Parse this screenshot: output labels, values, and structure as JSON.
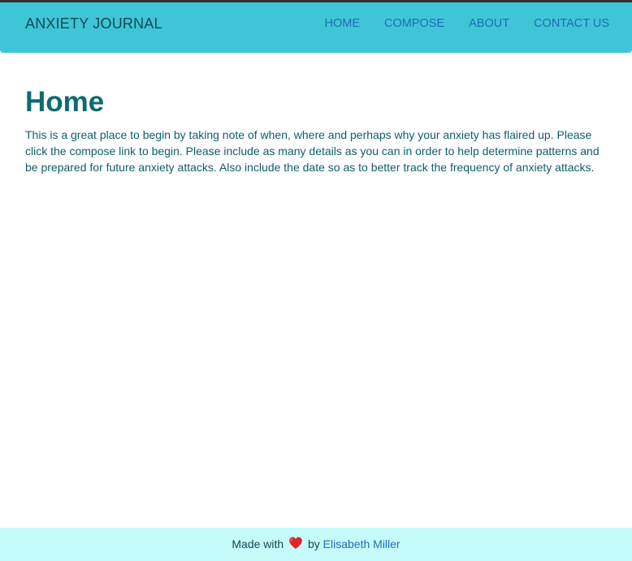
{
  "navbar": {
    "brand": "ANXIETY JOURNAL",
    "links": [
      {
        "label": "HOME"
      },
      {
        "label": "COMPOSE"
      },
      {
        "label": "ABOUT"
      },
      {
        "label": "CONTACT US"
      }
    ]
  },
  "main": {
    "title": "Home",
    "intro": "This is a great place to begin by taking note of when, where and perhaps why your anxiety has flaired up. Please click the compose link to begin. Please include as many details as you can in order to help determine patterns and be prepared for future anxiety attacks. Also include the date so as to better track the frequency of anxiety attacks."
  },
  "footer": {
    "made_with": "Made with",
    "heart_icon": "red-heart",
    "by": "by",
    "author": "Elisabeth Miller"
  },
  "colors": {
    "navbar_bg": "#3fc6d6",
    "footer_bg": "#c6fbfb",
    "title": "#0e6b70",
    "link": "#1a6fb5"
  }
}
